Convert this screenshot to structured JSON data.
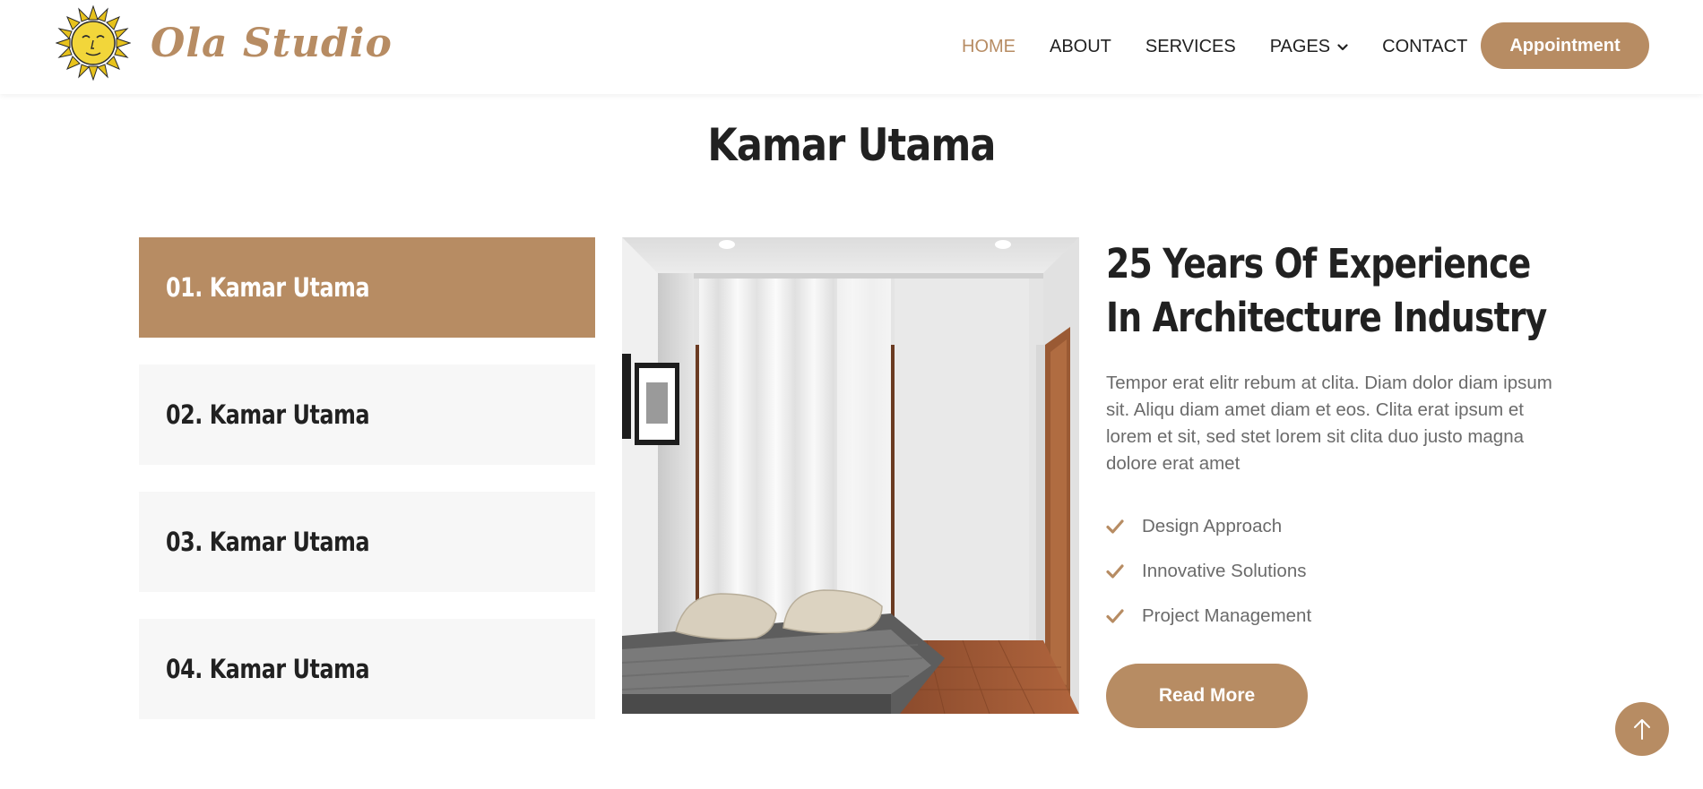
{
  "brand": {
    "name": "Ola Studio",
    "logo_icon": "sun-face-logo"
  },
  "nav": {
    "items": [
      {
        "label": "HOME",
        "active": true
      },
      {
        "label": "ABOUT"
      },
      {
        "label": "SERVICES"
      },
      {
        "label": "PAGES",
        "dropdown": true
      },
      {
        "label": "CONTACT"
      }
    ],
    "cta_label": "Appointment"
  },
  "section": {
    "title": "Kamar Utama"
  },
  "tabs": [
    {
      "label": "01. Kamar Utama",
      "active": true
    },
    {
      "label": "02. Kamar Utama"
    },
    {
      "label": "03. Kamar Utama"
    },
    {
      "label": "04. Kamar Utama"
    }
  ],
  "content": {
    "headline": "25 Years Of Experience In Architecture Industry",
    "paragraph": "Tempor erat elitr rebum at clita. Diam dolor diam ipsum sit. Aliqu diam amet diam et eos. Clita erat ipsum et lorem et sit, sed stet lorem sit clita duo justo magna dolore erat amet",
    "features": [
      "Design Approach",
      "Innovative Solutions",
      "Project Management"
    ],
    "button_label": "Read More"
  },
  "colors": {
    "accent": "#b78c63",
    "tab_bg": "#f7f7f7",
    "text_dark": "#212121",
    "text_muted": "#6b6b6b"
  },
  "icons": {
    "feature": "check-icon",
    "back_to_top": "arrow-up-icon",
    "dropdown": "chevron-down-icon"
  }
}
